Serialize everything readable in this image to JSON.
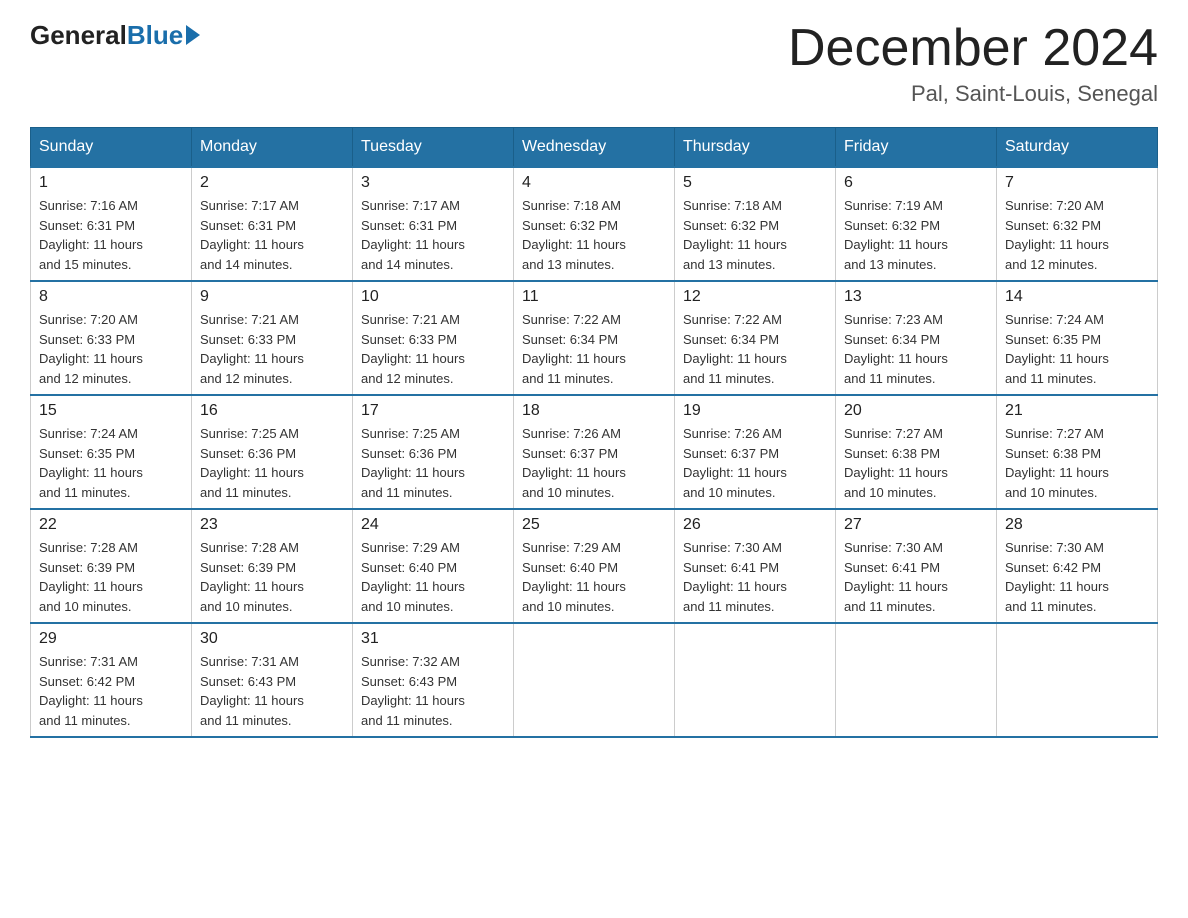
{
  "header": {
    "logo": {
      "general": "General",
      "blue": "Blue"
    },
    "title": "December 2024",
    "location": "Pal, Saint-Louis, Senegal"
  },
  "days_of_week": [
    "Sunday",
    "Monday",
    "Tuesday",
    "Wednesday",
    "Thursday",
    "Friday",
    "Saturday"
  ],
  "weeks": [
    [
      {
        "day": "1",
        "sunrise": "7:16 AM",
        "sunset": "6:31 PM",
        "daylight": "11 hours and 15 minutes."
      },
      {
        "day": "2",
        "sunrise": "7:17 AM",
        "sunset": "6:31 PM",
        "daylight": "11 hours and 14 minutes."
      },
      {
        "day": "3",
        "sunrise": "7:17 AM",
        "sunset": "6:31 PM",
        "daylight": "11 hours and 14 minutes."
      },
      {
        "day": "4",
        "sunrise": "7:18 AM",
        "sunset": "6:32 PM",
        "daylight": "11 hours and 13 minutes."
      },
      {
        "day": "5",
        "sunrise": "7:18 AM",
        "sunset": "6:32 PM",
        "daylight": "11 hours and 13 minutes."
      },
      {
        "day": "6",
        "sunrise": "7:19 AM",
        "sunset": "6:32 PM",
        "daylight": "11 hours and 13 minutes."
      },
      {
        "day": "7",
        "sunrise": "7:20 AM",
        "sunset": "6:32 PM",
        "daylight": "11 hours and 12 minutes."
      }
    ],
    [
      {
        "day": "8",
        "sunrise": "7:20 AM",
        "sunset": "6:33 PM",
        "daylight": "11 hours and 12 minutes."
      },
      {
        "day": "9",
        "sunrise": "7:21 AM",
        "sunset": "6:33 PM",
        "daylight": "11 hours and 12 minutes."
      },
      {
        "day": "10",
        "sunrise": "7:21 AM",
        "sunset": "6:33 PM",
        "daylight": "11 hours and 12 minutes."
      },
      {
        "day": "11",
        "sunrise": "7:22 AM",
        "sunset": "6:34 PM",
        "daylight": "11 hours and 11 minutes."
      },
      {
        "day": "12",
        "sunrise": "7:22 AM",
        "sunset": "6:34 PM",
        "daylight": "11 hours and 11 minutes."
      },
      {
        "day": "13",
        "sunrise": "7:23 AM",
        "sunset": "6:34 PM",
        "daylight": "11 hours and 11 minutes."
      },
      {
        "day": "14",
        "sunrise": "7:24 AM",
        "sunset": "6:35 PM",
        "daylight": "11 hours and 11 minutes."
      }
    ],
    [
      {
        "day": "15",
        "sunrise": "7:24 AM",
        "sunset": "6:35 PM",
        "daylight": "11 hours and 11 minutes."
      },
      {
        "day": "16",
        "sunrise": "7:25 AM",
        "sunset": "6:36 PM",
        "daylight": "11 hours and 11 minutes."
      },
      {
        "day": "17",
        "sunrise": "7:25 AM",
        "sunset": "6:36 PM",
        "daylight": "11 hours and 11 minutes."
      },
      {
        "day": "18",
        "sunrise": "7:26 AM",
        "sunset": "6:37 PM",
        "daylight": "11 hours and 10 minutes."
      },
      {
        "day": "19",
        "sunrise": "7:26 AM",
        "sunset": "6:37 PM",
        "daylight": "11 hours and 10 minutes."
      },
      {
        "day": "20",
        "sunrise": "7:27 AM",
        "sunset": "6:38 PM",
        "daylight": "11 hours and 10 minutes."
      },
      {
        "day": "21",
        "sunrise": "7:27 AM",
        "sunset": "6:38 PM",
        "daylight": "11 hours and 10 minutes."
      }
    ],
    [
      {
        "day": "22",
        "sunrise": "7:28 AM",
        "sunset": "6:39 PM",
        "daylight": "11 hours and 10 minutes."
      },
      {
        "day": "23",
        "sunrise": "7:28 AM",
        "sunset": "6:39 PM",
        "daylight": "11 hours and 10 minutes."
      },
      {
        "day": "24",
        "sunrise": "7:29 AM",
        "sunset": "6:40 PM",
        "daylight": "11 hours and 10 minutes."
      },
      {
        "day": "25",
        "sunrise": "7:29 AM",
        "sunset": "6:40 PM",
        "daylight": "11 hours and 10 minutes."
      },
      {
        "day": "26",
        "sunrise": "7:30 AM",
        "sunset": "6:41 PM",
        "daylight": "11 hours and 11 minutes."
      },
      {
        "day": "27",
        "sunrise": "7:30 AM",
        "sunset": "6:41 PM",
        "daylight": "11 hours and 11 minutes."
      },
      {
        "day": "28",
        "sunrise": "7:30 AM",
        "sunset": "6:42 PM",
        "daylight": "11 hours and 11 minutes."
      }
    ],
    [
      {
        "day": "29",
        "sunrise": "7:31 AM",
        "sunset": "6:42 PM",
        "daylight": "11 hours and 11 minutes."
      },
      {
        "day": "30",
        "sunrise": "7:31 AM",
        "sunset": "6:43 PM",
        "daylight": "11 hours and 11 minutes."
      },
      {
        "day": "31",
        "sunrise": "7:32 AM",
        "sunset": "6:43 PM",
        "daylight": "11 hours and 11 minutes."
      },
      null,
      null,
      null,
      null
    ]
  ],
  "labels": {
    "sunrise": "Sunrise:",
    "sunset": "Sunset:",
    "daylight": "Daylight:"
  }
}
